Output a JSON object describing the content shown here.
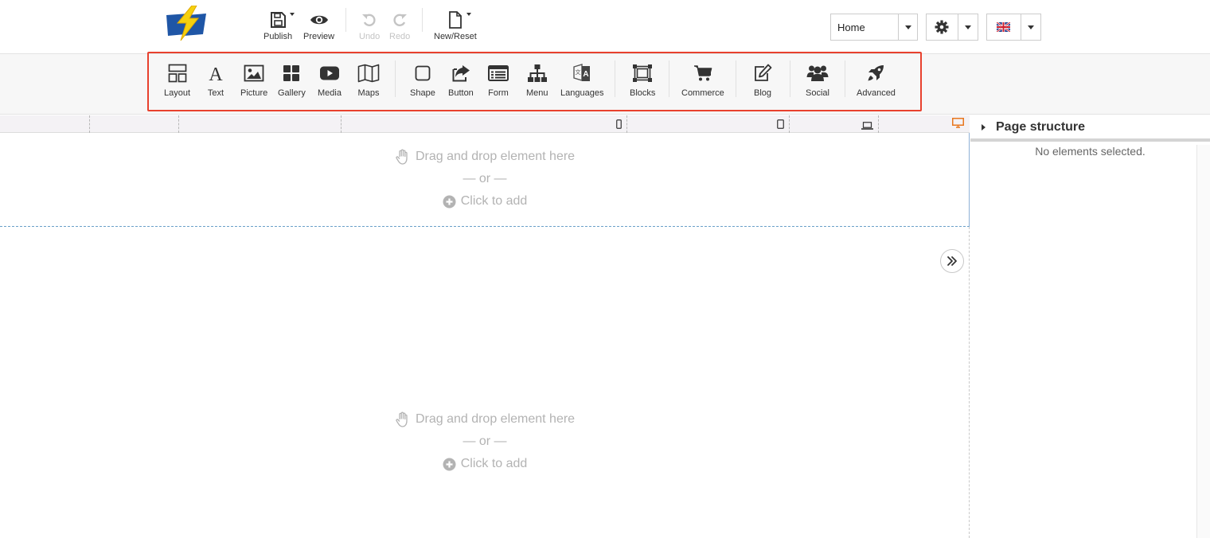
{
  "header": {
    "logo_icon": "lightning-logo-icon",
    "buttons": {
      "publish": "Publish",
      "preview": "Preview",
      "undo": "Undo",
      "redo": "Redo",
      "new_reset": "New/Reset"
    },
    "page_select": {
      "value": "Home"
    },
    "settings_icon": "gear-icon",
    "language_icon": "uk-flag-icon"
  },
  "toolbar": {
    "items": [
      {
        "label": "Layout",
        "icon": "layout-icon"
      },
      {
        "label": "Text",
        "icon": "text-icon"
      },
      {
        "label": "Picture",
        "icon": "picture-icon"
      },
      {
        "label": "Gallery",
        "icon": "gallery-icon"
      },
      {
        "label": "Media",
        "icon": "media-icon"
      },
      {
        "label": "Maps",
        "icon": "maps-icon"
      },
      {
        "label": "Shape",
        "icon": "shape-icon"
      },
      {
        "label": "Button",
        "icon": "button-icon"
      },
      {
        "label": "Form",
        "icon": "form-icon"
      },
      {
        "label": "Menu",
        "icon": "menu-icon"
      },
      {
        "label": "Languages",
        "icon": "languages-icon"
      },
      {
        "label": "Blocks",
        "icon": "blocks-icon"
      },
      {
        "label": "Commerce",
        "icon": "commerce-icon"
      },
      {
        "label": "Blog",
        "icon": "blog-icon"
      },
      {
        "label": "Social",
        "icon": "social-icon"
      },
      {
        "label": "Advanced",
        "icon": "advanced-icon"
      }
    ]
  },
  "canvas": {
    "dropzones": [
      {
        "drag_text": "Drag and drop element here",
        "or_text": "— or —",
        "click_text": "Click to add"
      },
      {
        "drag_text": "Drag and drop element here",
        "or_text": "— or —",
        "click_text": "Click to add"
      }
    ]
  },
  "panel": {
    "title": "Page structure",
    "empty_text": "No elements selected."
  },
  "colors": {
    "highlight": "#e8412e",
    "desktop_active": "#e8771e",
    "logo_blue": "#1f56a6",
    "logo_yellow": "#f5d10d"
  }
}
